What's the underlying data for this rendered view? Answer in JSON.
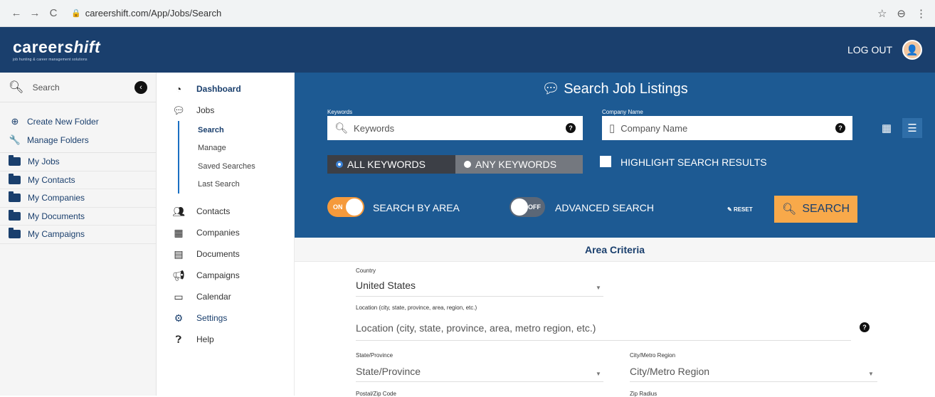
{
  "browser": {
    "url": "careershift.com/App/Jobs/Search",
    "back": "←",
    "forward": "→",
    "reload": "C",
    "star": "☆",
    "profile": "⊖",
    "menu": "⋮"
  },
  "header": {
    "logo_main": "career",
    "logo_italic": "shift",
    "logo_tag": "job hunting & career management solutions",
    "logout": "LOG OUT"
  },
  "sidebar": {
    "search_placeholder": "Search",
    "create_folder": "Create New Folder",
    "manage_folders": "Manage Folders",
    "folders": [
      "My Jobs",
      "My Contacts",
      "My Companies",
      "My Documents",
      "My Campaigns"
    ]
  },
  "nav": {
    "dashboard": "Dashboard",
    "jobs": "Jobs",
    "jobs_sub": [
      "Search",
      "Manage",
      "Saved Searches",
      "Last Search"
    ],
    "contacts": "Contacts",
    "companies": "Companies",
    "documents": "Documents",
    "campaigns": "Campaigns",
    "calendar": "Calendar",
    "settings": "Settings",
    "help": "Help"
  },
  "search_panel": {
    "title": "Search Job Listings",
    "keywords_label": "Keywords",
    "keywords_placeholder": "Keywords",
    "company_label": "Company Name",
    "company_placeholder": "Company Name",
    "all_keywords": "ALL KEYWORDS",
    "any_keywords": "ANY KEYWORDS",
    "highlight": "HIGHLIGHT SEARCH RESULTS",
    "search_by_area_state": "ON",
    "search_by_area": "SEARCH BY AREA",
    "advanced_state": "OFF",
    "advanced": "ADVANCED SEARCH",
    "reset": "RESET",
    "search_button": "SEARCH"
  },
  "area": {
    "title": "Area Criteria",
    "country_label": "Country",
    "country_value": "United States",
    "location_label": "Location (city, state, province, area, region, etc.)",
    "location_placeholder": "Location (city, state, province, area, metro region, etc.)",
    "state_label": "State/Province",
    "state_value": "State/Province",
    "city_label": "City/Metro Region",
    "city_value": "City/Metro Region",
    "postal_label": "Postal/Zip Code",
    "radius_label": "Zip Radius"
  }
}
